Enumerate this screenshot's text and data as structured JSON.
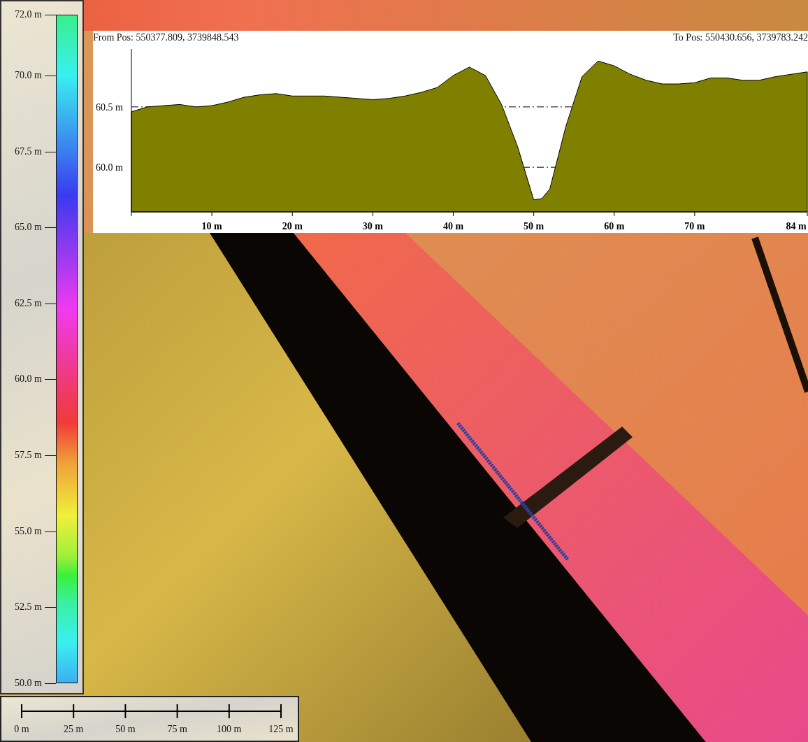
{
  "color_scale": {
    "labels": [
      "72.0 m",
      "70.0 m",
      "67.5 m",
      "65.0 m",
      "62.5 m",
      "60.0 m",
      "57.5 m",
      "55.0 m",
      "52.5 m",
      "50.0 m"
    ]
  },
  "profile": {
    "from_label": "From Pos: 550377.809, 3739848.543",
    "to_label": "To Pos: 550430.656, 3739783.242",
    "chart_data": {
      "type": "area",
      "x": [
        0,
        2,
        4,
        6,
        8,
        10,
        12,
        14,
        16,
        18,
        20,
        22,
        24,
        26,
        28,
        30,
        32,
        34,
        36,
        38,
        40,
        42,
        44,
        46,
        48,
        50,
        51,
        52,
        54,
        56,
        58,
        60,
        62,
        64,
        66,
        68,
        70,
        72,
        74,
        76,
        78,
        80,
        82,
        84
      ],
      "series": [
        {
          "color": "#808000",
          "values": [
            60.46,
            60.5,
            60.51,
            60.52,
            60.5,
            60.51,
            60.54,
            60.58,
            60.6,
            60.61,
            60.59,
            60.59,
            60.59,
            60.58,
            60.57,
            60.56,
            60.57,
            60.59,
            60.62,
            60.66,
            60.76,
            60.83,
            60.76,
            60.52,
            60.17,
            59.73,
            59.74,
            59.82,
            60.34,
            60.75,
            60.88,
            60.84,
            60.77,
            60.72,
            60.69,
            60.69,
            60.7,
            60.74,
            60.74,
            60.72,
            60.72,
            60.75,
            60.77,
            60.79
          ]
        }
      ],
      "xlim": [
        0,
        84
      ],
      "ylim": [
        59.63,
        60.98
      ],
      "xticks": [
        {
          "value": 10,
          "label": "10 m"
        },
        {
          "value": 20,
          "label": "20 m"
        },
        {
          "value": 30,
          "label": "30 m"
        },
        {
          "value": 40,
          "label": "40 m"
        },
        {
          "value": 50,
          "label": "50 m"
        },
        {
          "value": 60,
          "label": "60 m"
        },
        {
          "value": 70,
          "label": "70 m"
        },
        {
          "value": 84,
          "label": "84 m"
        }
      ],
      "yticks": [
        {
          "value": 60.0,
          "label": "60.0 m"
        },
        {
          "value": 60.5,
          "label": "60.5 m"
        }
      ]
    }
  },
  "scale_bar": {
    "labels": [
      "0 m",
      "25 m",
      "50 m",
      "75 m",
      "100 m",
      "125 m"
    ]
  }
}
